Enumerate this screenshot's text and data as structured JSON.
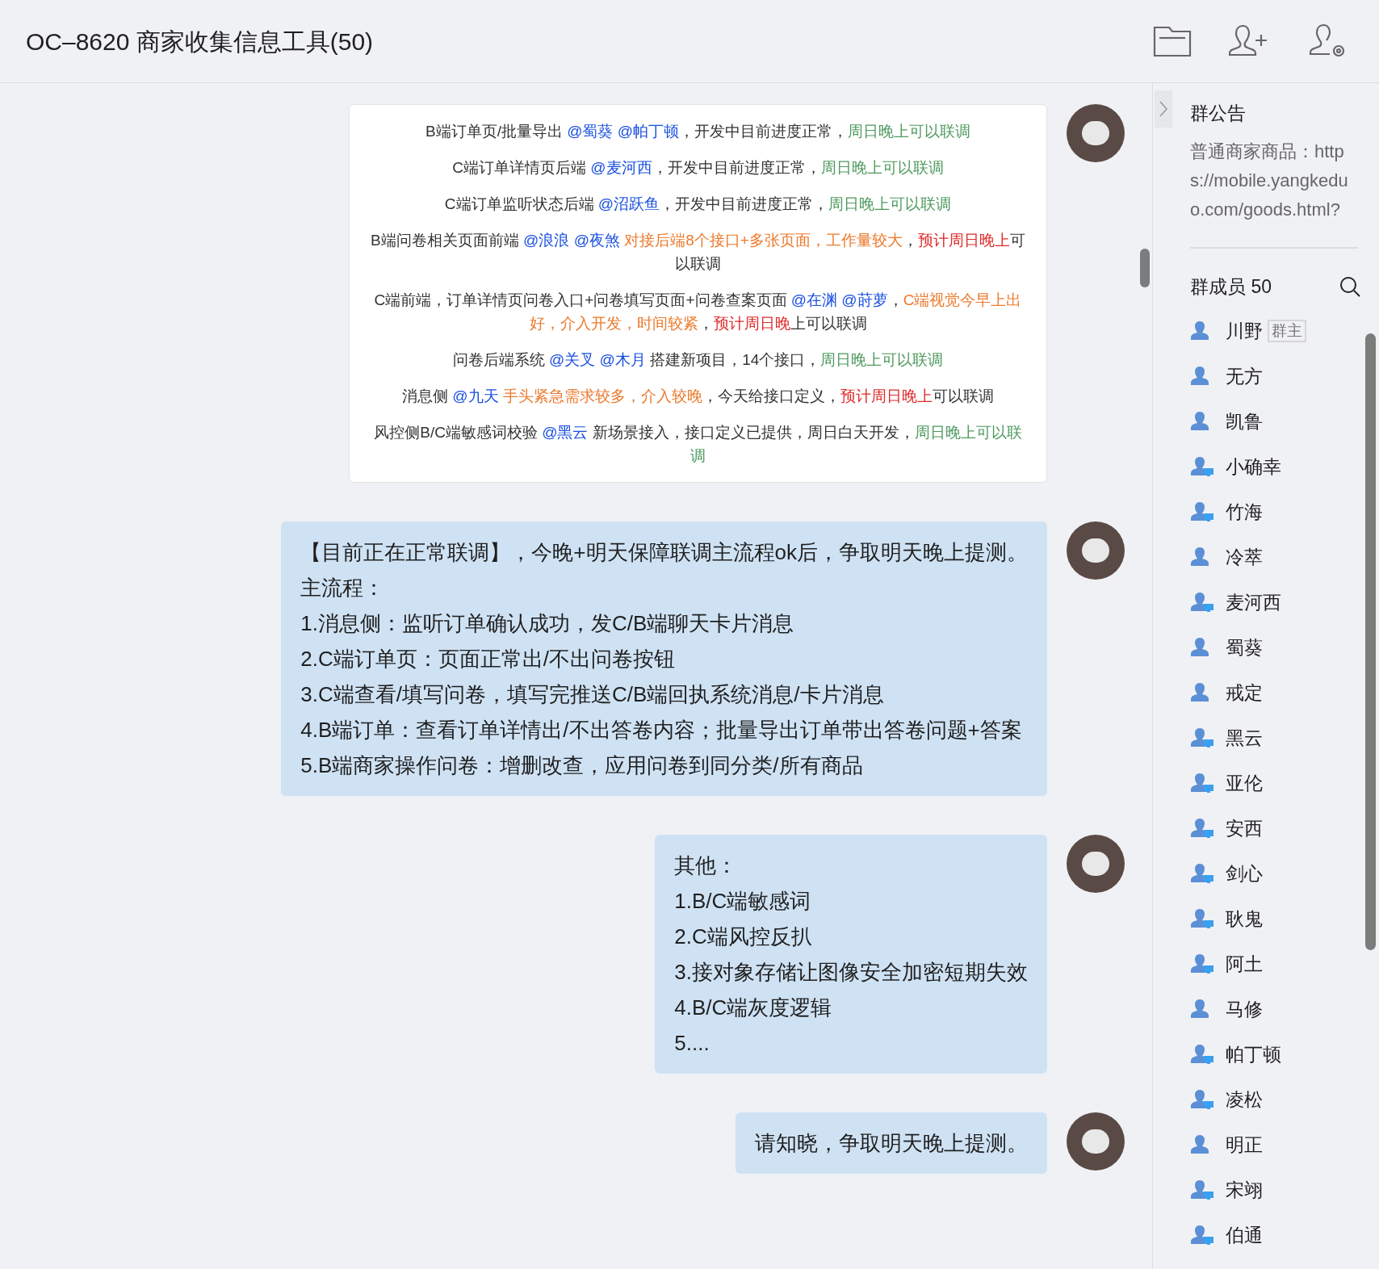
{
  "window": {
    "title": "OC–8620 商家收集信息工具(50)"
  },
  "messages": [
    {
      "kind": "image",
      "lines": [
        [
          {
            "kind": "plain",
            "text": "B端订单页/批量导出 "
          },
          {
            "kind": "mention",
            "text": "@蜀葵 @帕丁顿"
          },
          {
            "kind": "plain",
            "text": "，开发中目前进度正常，"
          },
          {
            "kind": "green",
            "text": "周日晚上可以联调"
          }
        ],
        [
          {
            "kind": "plain",
            "text": "C端订单详情页后端 "
          },
          {
            "kind": "mention",
            "text": "@麦河西"
          },
          {
            "kind": "plain",
            "text": "，开发中目前进度正常，"
          },
          {
            "kind": "green",
            "text": "周日晚上可以联调"
          }
        ],
        [
          {
            "kind": "plain",
            "text": "C端订单监听状态后端 "
          },
          {
            "kind": "mention",
            "text": "@沼跃鱼"
          },
          {
            "kind": "plain",
            "text": "，开发中目前进度正常，"
          },
          {
            "kind": "green",
            "text": "周日晚上可以联调"
          }
        ],
        [
          {
            "kind": "plain",
            "text": "B端问卷相关页面前端 "
          },
          {
            "kind": "mention",
            "text": "@浪浪 @夜煞"
          },
          {
            "kind": "orange",
            "text": " 对接后端8个接口+多张页面，工作量较大"
          },
          {
            "kind": "plain",
            "text": "，"
          },
          {
            "kind": "red",
            "text": "预计周日晚上"
          },
          {
            "kind": "plain",
            "text": "可以联调"
          }
        ],
        [
          {
            "kind": "plain",
            "text": "C端前端，订单详情页问卷入口+问卷填写页面+问卷查案页面 "
          },
          {
            "kind": "mention",
            "text": "@在渊 @莳萝"
          },
          {
            "kind": "plain",
            "text": "，"
          },
          {
            "kind": "orange",
            "text": "C端视觉今早上出好，介入开发，时间较紧"
          },
          {
            "kind": "plain",
            "text": "，"
          },
          {
            "kind": "red",
            "text": "预计周日晚"
          },
          {
            "kind": "plain",
            "text": "上可以联调"
          }
        ],
        [
          {
            "kind": "plain",
            "text": "问卷后端系统 "
          },
          {
            "kind": "mention",
            "text": "@关叉 @木月"
          },
          {
            "kind": "plain",
            "text": " 搭建新项目，14个接口，"
          },
          {
            "kind": "green",
            "text": "周日晚上可以联调"
          }
        ],
        [
          {
            "kind": "plain",
            "text": "消息侧 "
          },
          {
            "kind": "mention",
            "text": "@九天"
          },
          {
            "kind": "orange",
            "text": " 手头紧急需求较多，介入较晚"
          },
          {
            "kind": "plain",
            "text": "，今天给接口定义，"
          },
          {
            "kind": "red",
            "text": "预计周日晚上"
          },
          {
            "kind": "plain",
            "text": "可以联调"
          }
        ],
        [
          {
            "kind": "plain",
            "text": "风控侧B/C端敏感词校验 "
          },
          {
            "kind": "mention",
            "text": "@黑云"
          },
          {
            "kind": "plain",
            "text": " 新场景接入，接口定义已提供，周日白天开发，"
          },
          {
            "kind": "green",
            "text": "周日晚上可以联调"
          }
        ]
      ]
    },
    {
      "kind": "text",
      "lines": [
        "【目前正在正常联调】，今晚+明天保障联调主流程ok后，争取明天晚上提测。",
        "主流程：",
        "1.消息侧：监听订单确认成功，发C/B端聊天卡片消息",
        "2.C端订单页：页面正常出/不出问卷按钮",
        "3.C端查看/填写问卷，填写完推送C/B端回执系统消息/卡片消息",
        "4.B端订单：查看订单详情出/不出答卷内容；批量导出订单带出答卷问题+答案",
        "5.B端商家操作问卷：增删改查，应用问卷到同分类/所有商品"
      ]
    },
    {
      "kind": "text",
      "lines": [
        "其他：",
        "1.B/C端敏感词",
        "2.C端风控反扒",
        "3.接对象存储让图像安全加密短期失效",
        "4.B/C端灰度逻辑",
        "5...."
      ]
    },
    {
      "kind": "text",
      "lines": [
        "请知晓，争取明天晚上提测。"
      ]
    }
  ],
  "announcement": {
    "title": "群公告",
    "text": "普通商家商品：https://mobile.yangkeduo.com/goods.html?"
  },
  "members": {
    "title": "群成员 50",
    "items": [
      {
        "name": "川野",
        "badge": "群主",
        "desktop": false
      },
      {
        "name": "无方",
        "desktop": false
      },
      {
        "name": "凯鲁",
        "desktop": false
      },
      {
        "name": "小确幸",
        "desktop": true
      },
      {
        "name": "竹海",
        "desktop": true
      },
      {
        "name": "冷萃",
        "desktop": false
      },
      {
        "name": "麦河西",
        "desktop": true
      },
      {
        "name": "蜀葵",
        "desktop": false
      },
      {
        "name": "戒定",
        "desktop": false
      },
      {
        "name": "黑云",
        "desktop": true
      },
      {
        "name": "亚伦",
        "desktop": true
      },
      {
        "name": "安西",
        "desktop": true
      },
      {
        "name": "剑心",
        "desktop": true
      },
      {
        "name": "耿鬼",
        "desktop": true
      },
      {
        "name": "阿土",
        "desktop": true
      },
      {
        "name": "马修",
        "desktop": false
      },
      {
        "name": "帕丁顿",
        "desktop": true
      },
      {
        "name": "凌松",
        "desktop": true
      },
      {
        "name": "明正",
        "desktop": false
      },
      {
        "name": "宋翊",
        "desktop": true
      },
      {
        "name": "伯通",
        "desktop": true
      }
    ]
  }
}
